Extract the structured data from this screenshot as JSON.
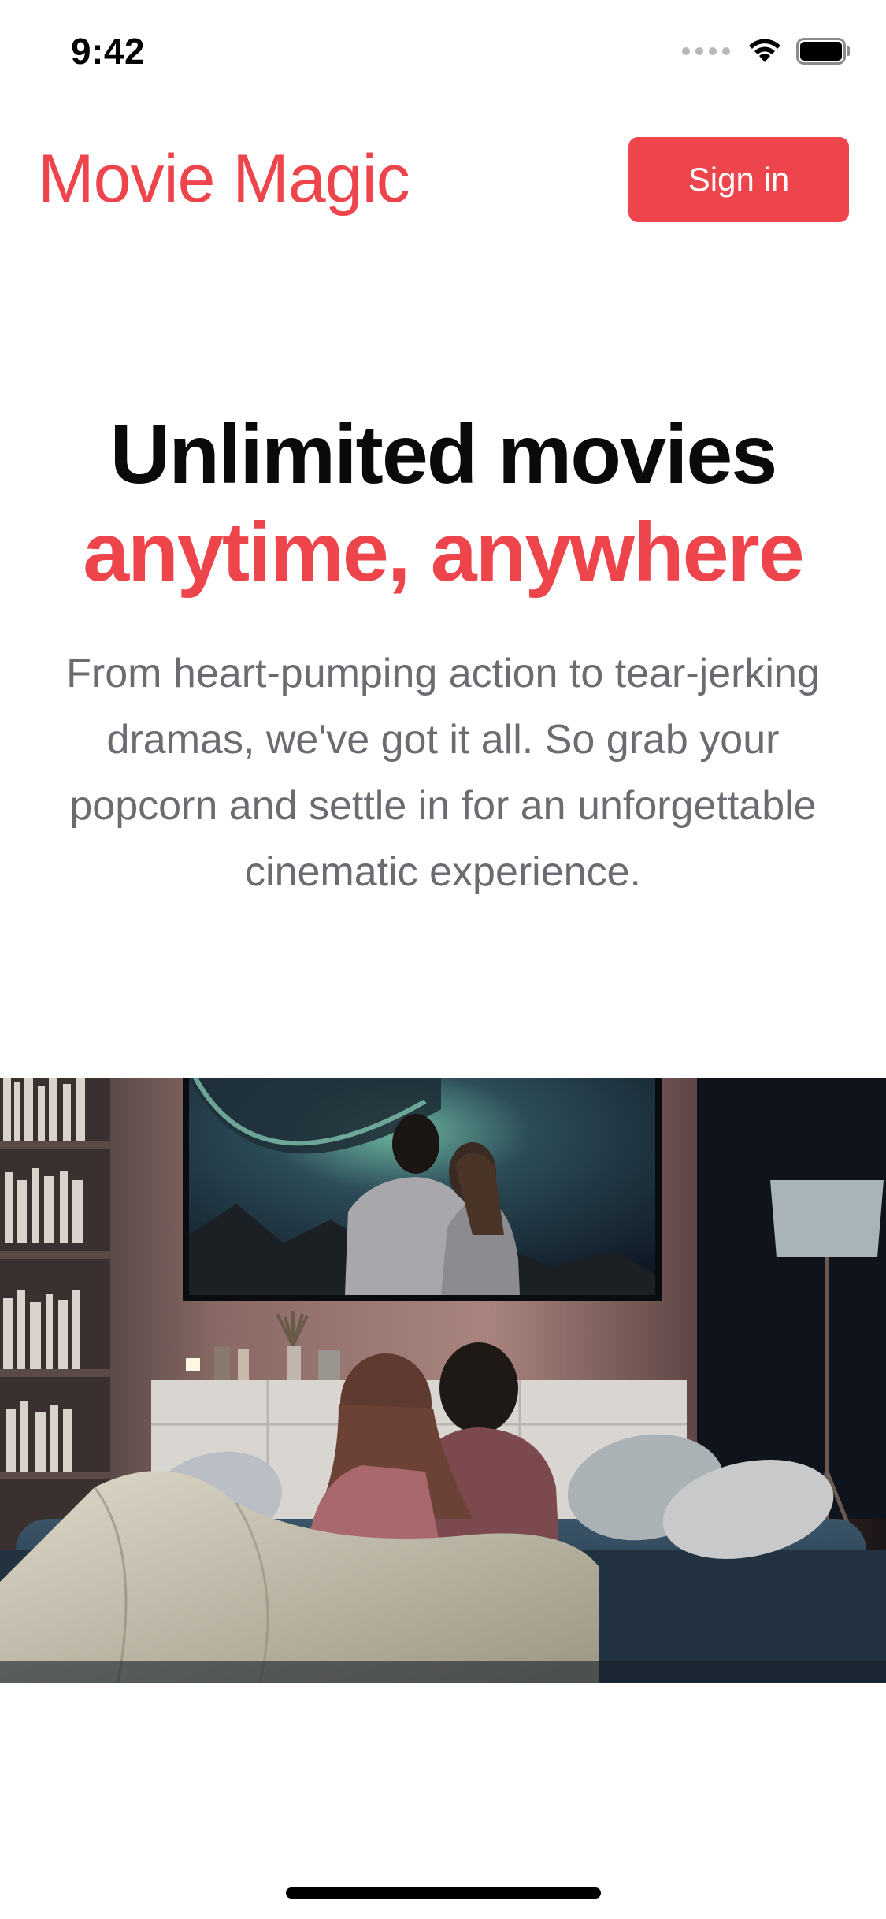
{
  "status_bar": {
    "time": "9:42"
  },
  "header": {
    "brand": "Movie Magic",
    "sign_in_label": "Sign in"
  },
  "hero": {
    "title_line1": "Unlimited movies",
    "title_line2": "anytime, anywhere",
    "description": "From heart-pumping action to tear-jerking dramas, we've got it all. So grab your popcorn and settle in for an unforgettable cinematic experience."
  },
  "icons": {
    "signal": "cellular-signal-icon",
    "wifi": "wifi-icon",
    "battery": "battery-icon"
  },
  "colors": {
    "accent": "#ee444b",
    "text_primary": "#0a0a0a",
    "text_secondary": "#6b6b72",
    "background": "#ffffff"
  }
}
